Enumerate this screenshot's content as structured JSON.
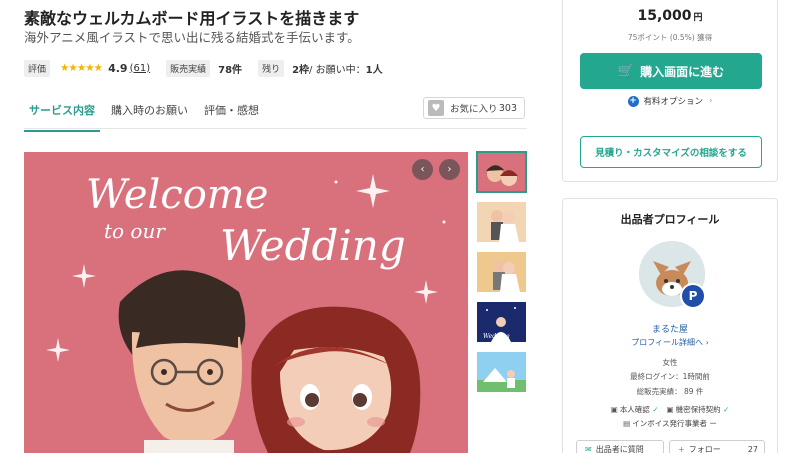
{
  "header": {
    "title": "素敵なウェルカムボード用イラストを描きます",
    "subtitle": "海外アニメ風イラストで思い出に残る結婚式を手伝います。"
  },
  "meta": {
    "rating_tag": "評価",
    "stars": "★★★★★",
    "rating_value": "4.9",
    "rating_count": "(61)",
    "sales_tag": "販売実績",
    "sales_value": "78件",
    "remaining_tag": "残り",
    "remaining_value": "2枠",
    "in_progress_label": " / お願い中：",
    "in_progress_value": "1人"
  },
  "tabs": [
    {
      "label": "サービス内容",
      "active": true
    },
    {
      "label": "購入時のお願い",
      "active": false
    },
    {
      "label": "評価・感想",
      "active": false
    }
  ],
  "favorite": {
    "label": "お気に入り",
    "count": "303",
    "icon": "heart-icon"
  },
  "gallery": {
    "main_text_1": "Welcome",
    "main_text_2": "to our",
    "main_text_3": "Wedding",
    "prev": "‹",
    "next": "›",
    "thumb_text": "Wedding"
  },
  "purchase": {
    "price": "15,000",
    "currency": "円",
    "points": "75ポイント (0.5%) 獲得",
    "buy_label": "購入画面に進む",
    "cart_icon": "🛒",
    "option_label": "有料オプション",
    "consult_label": "見積り・カスタマイズの相談をする"
  },
  "profile": {
    "title": "出品者プロフィール",
    "badge": "P",
    "name": "まるた屋",
    "detail_link": "プロフィール詳細へ",
    "gender": "女性",
    "last_login": "最終ログイン：1時間前",
    "total_sales": "総販売実績：  89 件",
    "identity": "本人確認",
    "nda": "機密保持契約",
    "invoice": "インボイス発行事業者",
    "invoice_value": "ー",
    "contact_label": "出品者に質問",
    "follow_label": "フォロー",
    "follow_count": "27"
  },
  "colors": {
    "accent": "#23a78f",
    "link": "#1f5fa8",
    "star": "#f5b400",
    "board_pink": "#d9717c"
  }
}
